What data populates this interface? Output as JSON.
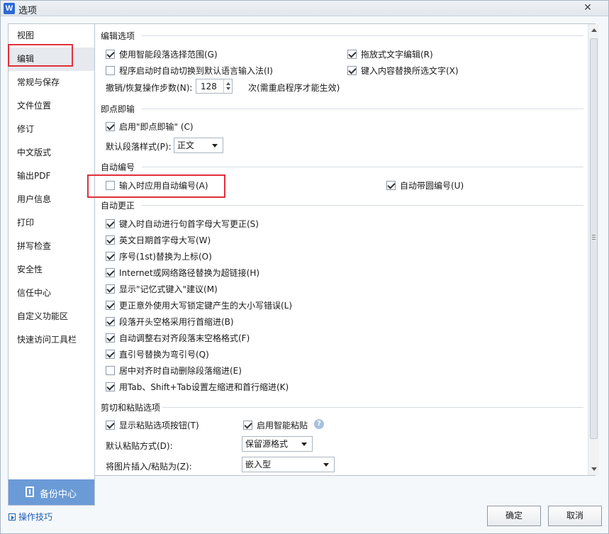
{
  "window": {
    "title": "选项",
    "app_icon": "W",
    "close_glyph": "✕"
  },
  "sidebar": {
    "items": [
      {
        "label": "视图"
      },
      {
        "label": "编辑"
      },
      {
        "label": "常规与保存"
      },
      {
        "label": "文件位置"
      },
      {
        "label": "修订"
      },
      {
        "label": "中文版式"
      },
      {
        "label": "输出PDF"
      },
      {
        "label": "用户信息"
      },
      {
        "label": "打印"
      },
      {
        "label": "拼写检查"
      },
      {
        "label": "安全性"
      },
      {
        "label": "信任中心"
      },
      {
        "label": "自定义功能区"
      },
      {
        "label": "快速访问工具栏"
      }
    ],
    "selected_index": 1,
    "backup_label": "备份中心",
    "tips_label": "操作技巧"
  },
  "edit_options": {
    "title": "编辑选项",
    "smart_select": {
      "label": "使用智能段落选择范围(G)",
      "checked": true
    },
    "drag_drop": {
      "label": "拖放式文字编辑(R)",
      "checked": true
    },
    "auto_ime": {
      "label": "程序启动时自动切换到默认语言输入法(I)",
      "checked": false
    },
    "typing_replace": {
      "label": "键入内容替换所选文字(X)",
      "checked": true
    },
    "undo_label": "撤销/恢复操作步数(N):",
    "undo_value": "128",
    "undo_suffix": "次(需重启程序才能生效)"
  },
  "click_and_type": {
    "title": "即点即输",
    "enable": {
      "label": "启用\"即点即输\" (C)",
      "checked": true
    },
    "para_style_label": "默认段落样式(P):",
    "para_style_value": "正文"
  },
  "auto_numbering": {
    "title": "自动编号",
    "apply_on_input": {
      "label": "输入时应用自动编号(A)",
      "checked": false
    },
    "circled": {
      "label": "自动带圆编号(U)",
      "checked": true
    }
  },
  "autocorrect": {
    "title": "自动更正",
    "items": [
      {
        "label": "键入时自动进行句首字母大写更正(S)",
        "checked": true
      },
      {
        "label": "英文日期首字母大写(W)",
        "checked": true
      },
      {
        "label": "序号(1st)替换为上标(O)",
        "checked": true
      },
      {
        "label": "Internet或网络路径替换为超链接(H)",
        "checked": true
      },
      {
        "label": "显示\"记忆式键入\"建议(M)",
        "checked": true
      },
      {
        "label": "更正意外使用大写锁定键产生的大小写错误(L)",
        "checked": true
      },
      {
        "label": "段落开头空格采用行首缩进(B)",
        "checked": true
      },
      {
        "label": "自动调整右对齐段落末空格格式(F)",
        "checked": true
      },
      {
        "label": "直引号替换为弯引号(Q)",
        "checked": true
      },
      {
        "label": "居中对齐时自动删除段落缩进(E)",
        "checked": false
      },
      {
        "label": "用Tab、Shift+Tab设置左缩进和首行缩进(K)",
        "checked": true
      }
    ]
  },
  "paste": {
    "title": "剪切和粘贴选项",
    "show_button": {
      "label": "显示粘贴选项按钮(T)",
      "checked": true
    },
    "smart_paste": {
      "label": "启用智能粘贴",
      "checked": true
    },
    "help_glyph": "?",
    "default_mode_label": "默认粘贴方式(D):",
    "default_mode_value": "保留源格式",
    "image_insert_label": "将图片插入/粘贴为(Z):",
    "image_insert_value": "嵌入型"
  },
  "footer": {
    "ok_label": "确定",
    "cancel_label": "取消"
  },
  "colors": {
    "highlight": "#e0303c",
    "backup_bg": "#6b9bd6",
    "link": "#1e5fb4"
  }
}
